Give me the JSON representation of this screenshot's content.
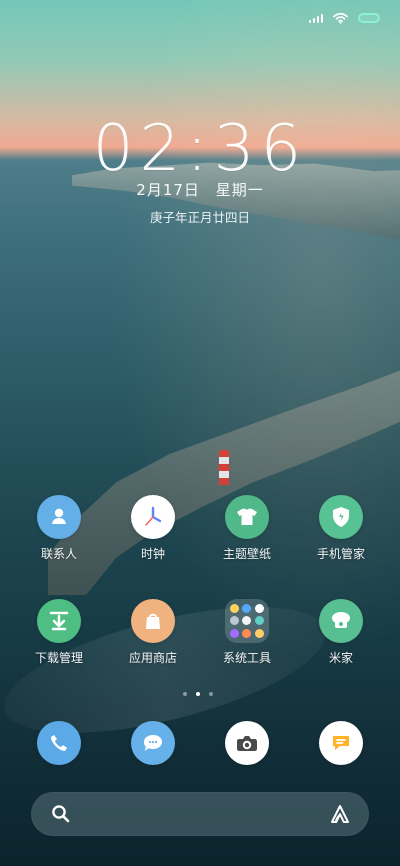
{
  "status_bar": {
    "signal_icon": "signal-icon",
    "wifi_icon": "wifi-icon",
    "battery_icon": "battery-icon",
    "battery_color": "#8ef0d5"
  },
  "lockscreen": {
    "time": "02:36",
    "date": "2月17日",
    "weekday": "星期一",
    "lunar": "庚子年正月廿四日"
  },
  "home": {
    "apps_row1": [
      {
        "label": "联系人",
        "icon": "contacts-icon"
      },
      {
        "label": "时钟",
        "icon": "clock-icon"
      },
      {
        "label": "主题壁纸",
        "icon": "theme-icon"
      },
      {
        "label": "手机管家",
        "icon": "security-icon"
      }
    ],
    "apps_row2": [
      {
        "label": "下载管理",
        "icon": "download-icon"
      },
      {
        "label": "应用商店",
        "icon": "store-icon"
      },
      {
        "label": "系统工具",
        "icon": "folder-icon"
      },
      {
        "label": "米家",
        "icon": "mi-home-icon"
      }
    ]
  },
  "dock": {
    "apps": [
      {
        "icon": "phone-icon"
      },
      {
        "icon": "messages-icon"
      },
      {
        "icon": "camera-icon"
      },
      {
        "icon": "notes-icon"
      }
    ]
  },
  "search": {
    "search_icon": "search-icon",
    "assistant_icon": "assistant-icon"
  },
  "colors": {
    "contacts": "#64afe8",
    "theme": "#51b88a",
    "security": "#57c394",
    "download": "#4ebe82",
    "store": "#f0b37f",
    "mi_home": "#57bf92",
    "phone": "#5ba9e6",
    "messages": "#67b1ea"
  }
}
